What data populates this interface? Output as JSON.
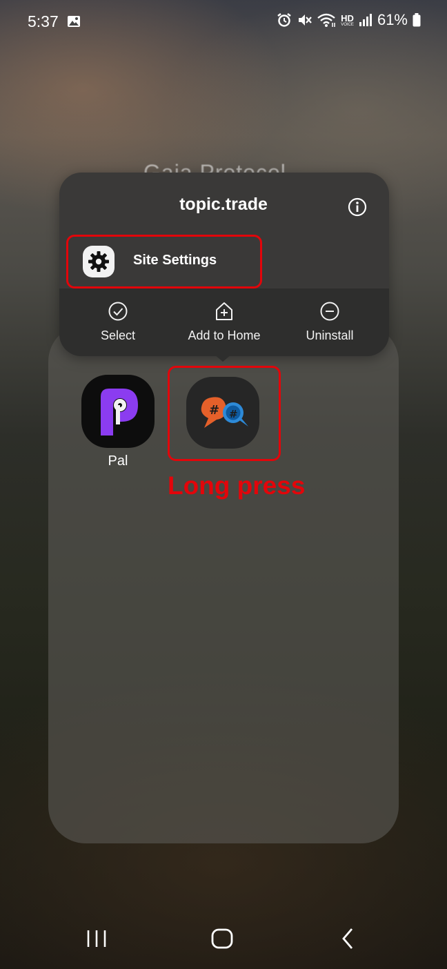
{
  "status_bar": {
    "time": "5:37",
    "battery_percent": "61%",
    "network_label_top": "HD",
    "network_label_bottom": "VOICE",
    "icons": [
      "gallery-icon",
      "alarm-icon",
      "mute-icon",
      "wifi-icon",
      "hd-voice-icon",
      "signal-icon",
      "battery-icon"
    ]
  },
  "background": {
    "folder_title": "Gaia Protocol"
  },
  "context_menu": {
    "title": "topic.trade",
    "site_settings_label": "Site Settings",
    "actions": [
      {
        "label": "Select",
        "icon": "check-circle-icon"
      },
      {
        "label": "Add to Home",
        "icon": "add-home-icon"
      },
      {
        "label": "Uninstall",
        "icon": "minus-circle-icon"
      }
    ]
  },
  "folder": {
    "apps": [
      {
        "label": "Pal",
        "icon": "pal-app-icon"
      },
      {
        "label": "",
        "icon": "topic-trade-app-icon"
      }
    ]
  },
  "annotation": {
    "text": "Long press",
    "color": "#e3050a"
  },
  "nav_bar": {
    "buttons": [
      "recents-icon",
      "home-icon",
      "back-icon"
    ]
  }
}
